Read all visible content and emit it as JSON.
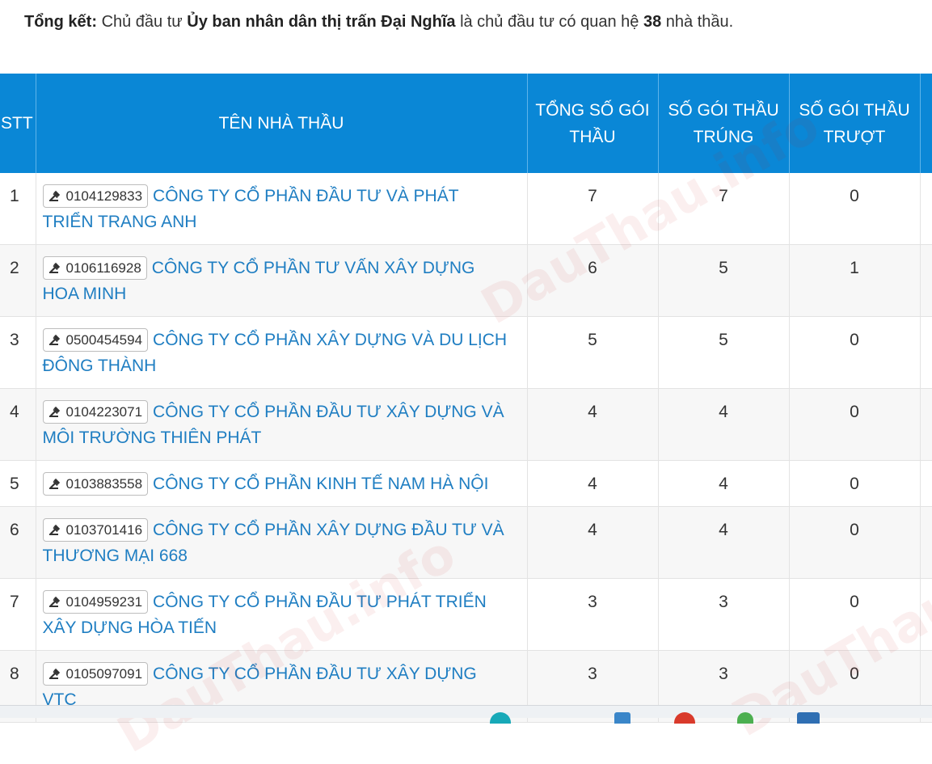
{
  "summary": {
    "label": "Tổng kết:",
    "text1": "Chủ đầu tư",
    "investor": "Ủy ban nhân dân thị trấn Đại Nghĩa",
    "text2": "là chủ đầu tư có quan hệ",
    "count": "38",
    "text3": "nhà thầu."
  },
  "table": {
    "headers": {
      "stt": "STT",
      "name": "TÊN NHÀ THẦU",
      "total_line1": "TỔNG SỐ GÓI",
      "total_line2": "THẦU",
      "win_line1": "SỐ GÓI THẦU",
      "win_line2": "TRÚNG",
      "lose_line1": "SỐ GÓI THẦU",
      "lose_line2": "TRƯỢT"
    },
    "rows": [
      {
        "stt": "1",
        "code": "0104129833",
        "name": "CÔNG TY CỔ PHẦN ĐẦU TƯ VÀ PHÁT TRIỂN TRANG ANH",
        "total": "7",
        "win": "7",
        "lose": "0"
      },
      {
        "stt": "2",
        "code": "0106116928",
        "name": "CÔNG TY CỔ PHẦN TƯ VẤN XÂY DỰNG HOA MINH",
        "total": "6",
        "win": "5",
        "lose": "1"
      },
      {
        "stt": "3",
        "code": "0500454594",
        "name": "CÔNG TY CỔ PHẦN XÂY DỰNG VÀ DU LỊCH ĐÔNG THÀNH",
        "total": "5",
        "win": "5",
        "lose": "0"
      },
      {
        "stt": "4",
        "code": "0104223071",
        "name": "CÔNG TY CỔ PHẦN ĐẦU TƯ XÂY DỰNG VÀ MÔI TRƯỜNG THIÊN PHÁT",
        "total": "4",
        "win": "4",
        "lose": "0"
      },
      {
        "stt": "5",
        "code": "0103883558",
        "name": "CÔNG TY CỔ PHẦN KINH TẾ NAM HÀ NỘI",
        "total": "4",
        "win": "4",
        "lose": "0"
      },
      {
        "stt": "6",
        "code": "0103701416",
        "name": "CÔNG TY CỔ PHẦN XÂY DỰNG ĐẦU TƯ VÀ THƯƠNG MẠI 668",
        "total": "4",
        "win": "4",
        "lose": "0"
      },
      {
        "stt": "7",
        "code": "0104959231",
        "name": "CÔNG TY CỔ PHẦN ĐẦU TƯ PHÁT TRIỂN XÂY DỰNG HÒA TIẾN",
        "total": "3",
        "win": "3",
        "lose": "0"
      },
      {
        "stt": "8",
        "code": "0105097091",
        "name": "CÔNG TY CỔ PHẦN ĐẦU TƯ XÂY DỰNG VTC",
        "total": "3",
        "win": "3",
        "lose": "0"
      }
    ]
  },
  "watermark": "DauThau.info",
  "colors": {
    "header_bg": "#0a87d6",
    "link": "#1f7ec2",
    "row_alt": "#f7f7f7"
  }
}
